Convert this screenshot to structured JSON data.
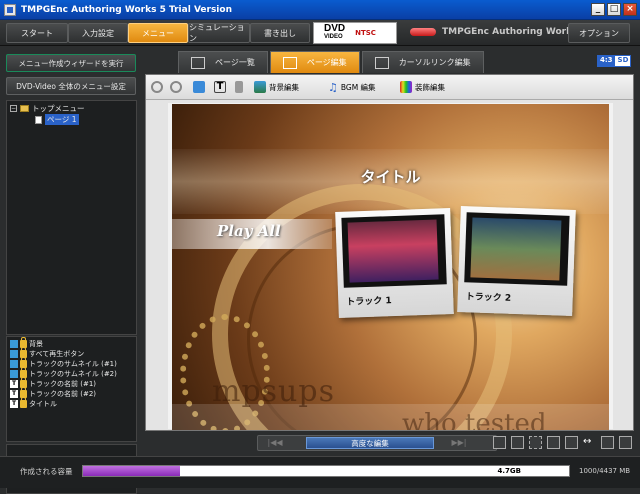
{
  "window": {
    "title": "TMPGEnc Authoring Works 5 Trial Version",
    "controls": [
      "_",
      "□",
      "×"
    ]
  },
  "toolbar": {
    "start": "スタート",
    "input": "入力設定",
    "menu": "メニュー",
    "simulation": "シミュレーション",
    "output": "書き出し",
    "dvd_logo": "DVD",
    "dvd_sub": "VIDEO",
    "ntsc": "NTSC",
    "brand": "TMPGEnc Authoring Works 5",
    "options": "オプション"
  },
  "left": {
    "wizard_button": "メニュー作成ウィザードを実行",
    "dvd_settings_button": "DVD-Video 全体のメニュー設定",
    "tree": {
      "expander": "−",
      "root": "トップメニュー",
      "child": "ページ 1"
    },
    "layers": [
      {
        "type": "img",
        "label": "背景"
      },
      {
        "type": "img",
        "label": "すべて再生ボタン"
      },
      {
        "type": "img",
        "label": "トラックのサムネイル (#1)"
      },
      {
        "type": "img",
        "label": "トラックのサムネイル (#2)"
      },
      {
        "type": "txt",
        "label": "トラックの名前 (#1)"
      },
      {
        "type": "txt",
        "label": "トラックの名前 (#2)"
      },
      {
        "type": "txt",
        "label": "タイトル"
      }
    ]
  },
  "tabs": {
    "page_list": "ページ一覧",
    "page_edit": "ページ編集",
    "cursor_link": "カーソルリンク編集",
    "aspect": "4:3",
    "sd": "SD"
  },
  "edit_tools": {
    "bg_edit": "背景編集",
    "bgm_edit": "BGM 編集",
    "decor_edit": "装飾編集"
  },
  "canvas": {
    "title": "タイトル",
    "play_all": "Play All",
    "track1": "トラック 1",
    "track2": "トラック 2",
    "bg_text_1": "mpsups",
    "bg_text_2": "who   tested"
  },
  "bottom": {
    "advanced_edit": "高度な編集",
    "prev": "|◀◀",
    "next": "▶▶|"
  },
  "status": {
    "label": "作成される容量",
    "bar_label": "4.7GB",
    "used_fraction": 0.2,
    "capacity_text": "1000/4437 MB"
  }
}
